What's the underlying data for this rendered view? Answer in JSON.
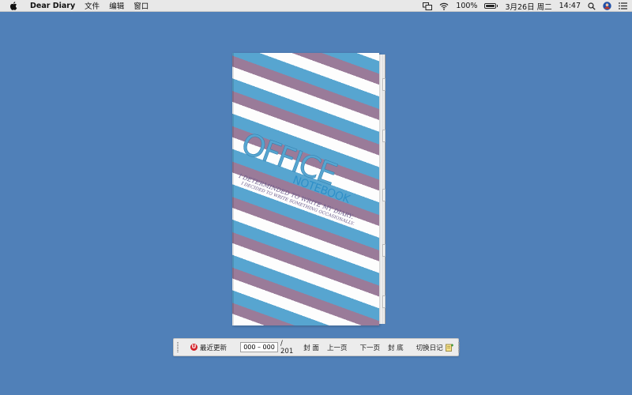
{
  "menubar": {
    "app_name": "Dear Diary",
    "menus": [
      "文件",
      "编辑",
      "窗口"
    ],
    "battery_percent": "100%",
    "battery_level": 1.0,
    "date": "3月26日 周二",
    "time": "14:47"
  },
  "cover": {
    "title": "OFFICE",
    "subtitle": "NOTEBOOK",
    "tagline_1": "I DETERMINDED TO WRITE MY DIARY.",
    "tagline_2": "I DECIDED TO WRITE SOMETHING OCCASIONALLY.",
    "colors": {
      "stripe_white": "#fdfdfd",
      "stripe_purple": "#9a7b99",
      "stripe_blue": "#57a5d0",
      "background": "#5080b8"
    }
  },
  "toolbar": {
    "recent_label": "最近更新",
    "page_value": "000 – 000",
    "page_total": "/ 201",
    "cover_label": "封 面",
    "prev_label": "上一页",
    "next_label": "下一页",
    "back_cover_label": "封 底",
    "switch_label": "切换日记"
  }
}
